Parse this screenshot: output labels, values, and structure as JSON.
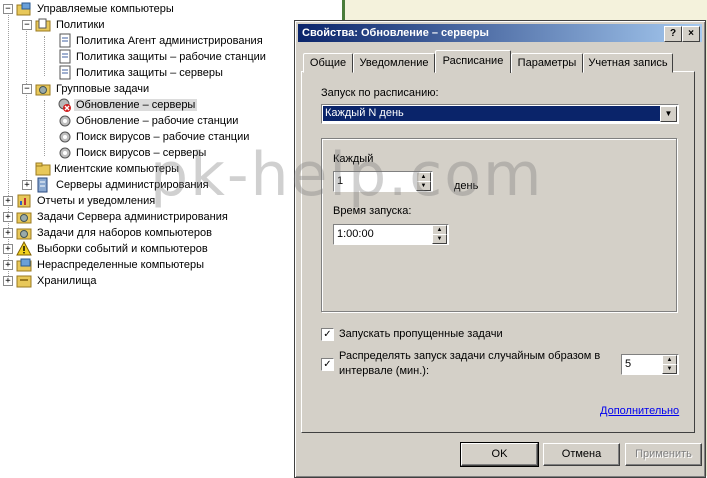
{
  "tree": {
    "nodes": [
      {
        "label": "Управляемые компьютеры",
        "icon": "folder-computers-icon",
        "expander": "−"
      },
      {
        "label": "Политики",
        "icon": "folder-policies-icon",
        "expander": "−"
      },
      {
        "label": "Политика Агент администрирования",
        "icon": "policy-icon"
      },
      {
        "label": "Политика защиты – рабочие станции",
        "icon": "policy-icon"
      },
      {
        "label": "Политика защиты – серверы",
        "icon": "policy-icon"
      },
      {
        "label": "Групповые задачи",
        "icon": "group-tasks-icon",
        "expander": "−"
      },
      {
        "label": "Обновление – серверы",
        "icon": "task-error-icon"
      },
      {
        "label": "Обновление – рабочие станции",
        "icon": "task-gear-icon"
      },
      {
        "label": "Поиск вирусов – рабочие станции",
        "icon": "task-gear-icon"
      },
      {
        "label": "Поиск вирусов – серверы",
        "icon": "task-gear-icon"
      },
      {
        "label": "Клиентские компьютеры",
        "icon": "folder-icon"
      },
      {
        "label": "Серверы администрирования",
        "icon": "servers-icon",
        "expander": "+"
      },
      {
        "label": "Отчеты и уведомления",
        "icon": "reports-icon",
        "expander": "+"
      },
      {
        "label": "Задачи Сервера администрирования",
        "icon": "server-tasks-icon",
        "expander": "+"
      },
      {
        "label": "Задачи для наборов компьютеров",
        "icon": "computer-tasks-icon",
        "expander": "+"
      },
      {
        "label": "Выборки событий и компьютеров",
        "icon": "warning-icon",
        "expander": "+"
      },
      {
        "label": "Нераспределенные компьютеры",
        "icon": "unassigned-icon",
        "expander": "+"
      },
      {
        "label": "Хранилища",
        "icon": "storage-icon",
        "expander": "+"
      }
    ]
  },
  "dialog": {
    "title": "Свойства: Обновление – серверы",
    "title_buttons": {
      "help": "?",
      "close": "×"
    },
    "tabs": [
      "Общие",
      "Уведомление",
      "Расписание",
      "Параметры",
      "Учетная запись"
    ],
    "active_tab": "Расписание",
    "schedule_label": "Запуск по расписанию:",
    "schedule_value": "Каждый N день",
    "every_label": "Каждый",
    "every_value": "1",
    "every_unit": "день",
    "start_time_label": "Время запуска:",
    "start_time_value": "1:00:00",
    "run_missed_label": "Запускать пропущенные задачи",
    "run_missed_checked": true,
    "randomize_label_1": "Распределять запуск задачи случайным образом в",
    "randomize_label_2": "интервале (мин.):",
    "randomize_checked": true,
    "randomize_value": "5",
    "advanced_link": "Дополнительно",
    "buttons": {
      "ok": "OK",
      "cancel": "Отмена",
      "apply": "Применить"
    }
  },
  "watermark": "pk-help.com",
  "colors": {
    "titlebar_start": "#0a246a",
    "titlebar_end": "#a6caf0",
    "dialog_bg": "#d4d0c8",
    "selection": "#0a246a",
    "link": "#0000ee"
  }
}
